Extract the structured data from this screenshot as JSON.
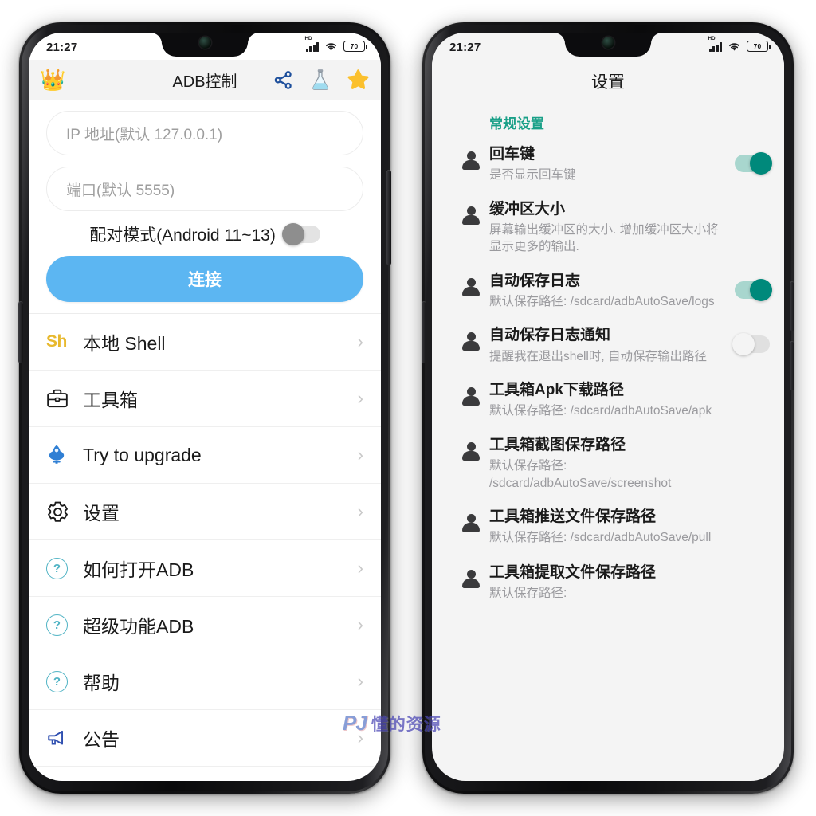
{
  "status_bar": {
    "time": "21:27",
    "network_tag": "HD",
    "battery_level": "70",
    "signal_icon": "signal-bars-icon",
    "wifi_icon": "wifi-icon",
    "battery_icon": "battery-icon"
  },
  "left_phone": {
    "appbar": {
      "crown_icon": "crown-icon",
      "title": "ADB控制",
      "actions": [
        {
          "icon": "share-icon",
          "name": "share-button"
        },
        {
          "icon": "flask-icon",
          "name": "lab-button"
        },
        {
          "icon": "star-icon",
          "name": "favorite-button"
        }
      ]
    },
    "form": {
      "ip_placeholder": "IP 地址(默认 127.0.0.1)",
      "ip_value": "",
      "port_placeholder": "端口(默认 5555)",
      "port_value": "",
      "pair_mode_label": "配对模式(Android 11~13)",
      "pair_mode_on": false,
      "connect_label": "连接"
    },
    "menu": [
      {
        "icon": "shell-badge-icon",
        "label": "本地 Shell"
      },
      {
        "icon": "toolbox-icon",
        "label": "工具箱"
      },
      {
        "icon": "rocket-icon",
        "label": "Try to upgrade"
      },
      {
        "icon": "gear-icon",
        "label": "设置"
      },
      {
        "icon": "question-circle-icon",
        "label": "如何打开ADB"
      },
      {
        "icon": "question-circle-icon",
        "label": "超级功能ADB"
      },
      {
        "icon": "question-circle-icon",
        "label": "帮助"
      },
      {
        "icon": "megaphone-icon",
        "label": "公告"
      }
    ],
    "shell_badge_text": "Sh",
    "chevron": "›"
  },
  "right_phone": {
    "title": "设置",
    "section_header": "常规设置",
    "items": [
      {
        "icon": "person-icon",
        "title": "回车键",
        "subtitle": "是否显示回车键",
        "toggle": "on"
      },
      {
        "icon": "person-icon",
        "title": "缓冲区大小",
        "subtitle": "屏幕输出缓冲区的大小. 增加缓冲区大小将显示更多的输出.",
        "toggle": "none"
      },
      {
        "icon": "person-icon",
        "title": "自动保存日志",
        "subtitle": "默认保存路径: /sdcard/adbAutoSave/logs",
        "toggle": "on"
      },
      {
        "icon": "person-icon",
        "title": "自动保存日志通知",
        "subtitle": "提醒我在退出shell时, 自动保存输出路径",
        "toggle": "off"
      },
      {
        "icon": "person-icon",
        "title": "工具箱Apk下载路径",
        "subtitle": "默认保存路径: /sdcard/adbAutoSave/apk",
        "toggle": "none"
      },
      {
        "icon": "person-icon",
        "title": "工具箱截图保存路径",
        "subtitle": "默认保存路径: /sdcard/adbAutoSave/screenshot",
        "toggle": "none"
      },
      {
        "icon": "person-icon",
        "title": "工具箱推送文件保存路径",
        "subtitle": "默认保存路径: /sdcard/adbAutoSave/pull",
        "toggle": "none"
      },
      {
        "icon": "person-icon",
        "title": "工具箱提取文件保存路径",
        "subtitle": "默认保存路径:",
        "toggle": "none"
      }
    ]
  },
  "watermark": {
    "logo": "PJ",
    "text": "懂的资源"
  },
  "colors": {
    "accent_blue": "#5cb6f2",
    "accent_teal": "#1aa088",
    "toggle_on": "#00897b",
    "toggle_off": "#e0e0e0",
    "shell_yellow": "#e8b92e",
    "question_cyan": "#4fb3c4"
  }
}
